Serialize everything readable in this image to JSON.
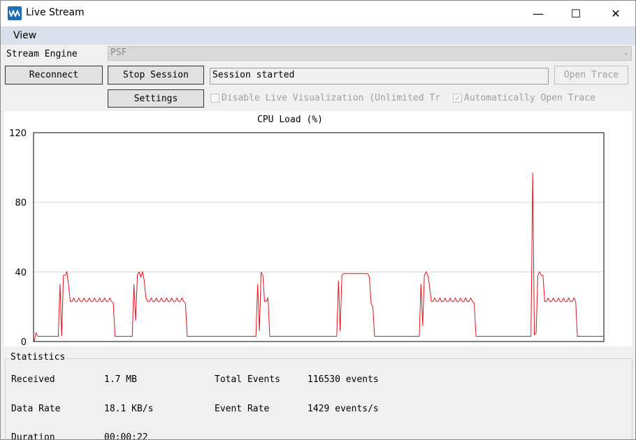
{
  "window": {
    "title": "Live Stream",
    "minimize": "—",
    "maximize": "☐",
    "close": "✕"
  },
  "menu": {
    "view": "View"
  },
  "controls": {
    "stream_engine_label": "Stream Engine",
    "stream_engine_value": "PSF",
    "reconnect": "Reconnect",
    "stop_session": "Stop Session",
    "session_status": "Session started",
    "open_trace": "Open Trace",
    "settings": "Settings",
    "disable_live_viz": "Disable Live Visualization (Unlimited Tr",
    "disable_live_viz_checked": false,
    "auto_open_trace": "Automatically Open Trace",
    "auto_open_trace_checked": true
  },
  "statistics": {
    "title": "Statistics",
    "received_label": "Received",
    "received_value": "1.7 MB",
    "total_events_label": "Total Events",
    "total_events_value": "116530 events",
    "data_rate_label": "Data Rate",
    "data_rate_value": "18.1 KB/s",
    "event_rate_label": "Event Rate",
    "event_rate_value": "1429 events/s",
    "duration_label": "Duration",
    "duration_value": "00:00:22"
  },
  "chart_data": {
    "type": "line",
    "title": "CPU Load (%)",
    "xlabel": "",
    "ylabel": "",
    "ylim": [
      0,
      120
    ],
    "yticks": [
      "0",
      "40",
      "80",
      "120"
    ],
    "grid": true,
    "color": "#e8101a",
    "series": [
      {
        "values": [
          0,
          5,
          3,
          3,
          3,
          3,
          3,
          3,
          3,
          3,
          3,
          3,
          3,
          3,
          3,
          33,
          3,
          38,
          38,
          40,
          32,
          23,
          23,
          25,
          23,
          23,
          25,
          23,
          23,
          25,
          23,
          23,
          25,
          23,
          23,
          25,
          23,
          23,
          25,
          23,
          23,
          25,
          23,
          23,
          25,
          23,
          22,
          3,
          3,
          3,
          3,
          3,
          3,
          3,
          3,
          3,
          3,
          3,
          33,
          12,
          38,
          40,
          37,
          40,
          35,
          25,
          23,
          23,
          25,
          23,
          23,
          25,
          23,
          23,
          25,
          23,
          23,
          25,
          23,
          23,
          25,
          23,
          23,
          25,
          23,
          23,
          25,
          23,
          22,
          3,
          3,
          3,
          3,
          3,
          3,
          3,
          3,
          3,
          3,
          3,
          3,
          3,
          3,
          3,
          3,
          3,
          3,
          3,
          3,
          3,
          3,
          3,
          3,
          3,
          3,
          3,
          3,
          3,
          3,
          3,
          3,
          3,
          3,
          3,
          3,
          3,
          3,
          3,
          3,
          3,
          33,
          6,
          40,
          38,
          23,
          23,
          25,
          3,
          3,
          3,
          3,
          3,
          3,
          3,
          3,
          3,
          3,
          3,
          3,
          3,
          3,
          3,
          3,
          3,
          3,
          3,
          3,
          3,
          3,
          3,
          3,
          3,
          3,
          3,
          3,
          3,
          3,
          3,
          3,
          3,
          3,
          3,
          3,
          3,
          3,
          3,
          3,
          35,
          6,
          38,
          39,
          39,
          39,
          39,
          39,
          39,
          39,
          39,
          39,
          39,
          39,
          39,
          39,
          39,
          39,
          37,
          22,
          20,
          3,
          3,
          3,
          3,
          3,
          3,
          3,
          3,
          3,
          3,
          3,
          3,
          3,
          3,
          3,
          3,
          3,
          3,
          3,
          3,
          3,
          3,
          3,
          3,
          3,
          3,
          3,
          33,
          9,
          38,
          40,
          38,
          32,
          23,
          23,
          25,
          23,
          23,
          25,
          23,
          23,
          25,
          23,
          23,
          25,
          23,
          23,
          25,
          23,
          23,
          25,
          23,
          23,
          25,
          23,
          23,
          25,
          23,
          22,
          3,
          3,
          3,
          3,
          3,
          3,
          3,
          3,
          3,
          3,
          3,
          3,
          3,
          3,
          3,
          3,
          3,
          3,
          3,
          3,
          3,
          3,
          3,
          3,
          3,
          3,
          3,
          3,
          3,
          3,
          3,
          3,
          3,
          97,
          4,
          5,
          38,
          40,
          38,
          38,
          23,
          23,
          25,
          23,
          23,
          25,
          23,
          23,
          25,
          23,
          23,
          25,
          23,
          23,
          25,
          23,
          23,
          25,
          23,
          3,
          3,
          3,
          3,
          3,
          3,
          3,
          3,
          3,
          3,
          3,
          3,
          3,
          3,
          3,
          3
        ]
      }
    ]
  }
}
